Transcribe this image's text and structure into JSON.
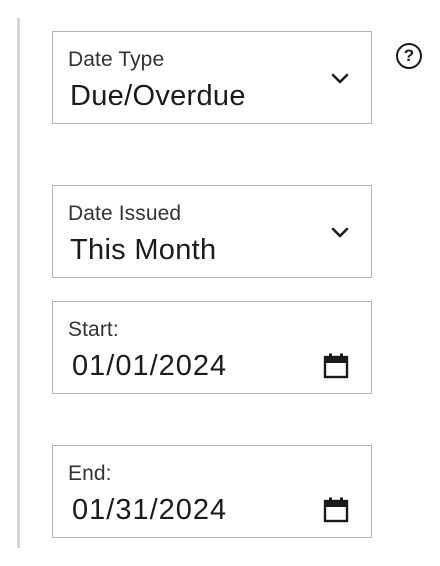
{
  "date_type": {
    "label": "Date Type",
    "value": "Due/Overdue",
    "icon": "chevron-down-icon"
  },
  "help": {
    "glyph": "?",
    "icon": "help-icon"
  },
  "date_issued": {
    "label": "Date Issued",
    "value": "This Month",
    "icon": "chevron-down-icon"
  },
  "start": {
    "label": "Start:",
    "value": "01/01/2024",
    "icon": "calendar-icon"
  },
  "end": {
    "label": "End:",
    "value": "01/31/2024",
    "icon": "calendar-icon"
  }
}
